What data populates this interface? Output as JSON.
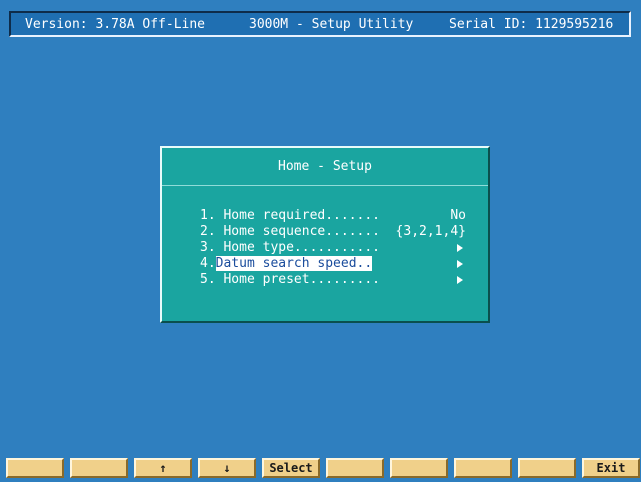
{
  "header": {
    "version": "Version: 3.78A Off-Line",
    "title": "3000M - Setup Utility",
    "serial": "Serial ID: 1129595216"
  },
  "dialog": {
    "title": "Home - Setup",
    "items": [
      {
        "label": "1. Home required.......",
        "value": "No",
        "submenu": false
      },
      {
        "label": "2. Home sequence.......",
        "value": "{3,2,1,4}",
        "submenu": false
      },
      {
        "label": "3. Home type...........",
        "value": "",
        "submenu": true
      },
      {
        "label_prefix": "4.",
        "label": "Datum search speed..",
        "value": "",
        "submenu": true,
        "selected": true
      },
      {
        "label": "5. Home preset.........",
        "value": "",
        "submenu": true
      }
    ]
  },
  "function_keys": [
    "",
    "",
    "↑",
    "↓",
    "Select",
    "",
    "",
    "",
    "",
    "Exit"
  ],
  "colors": {
    "background": "#2f7fbf",
    "dialog": "#1aa5a0",
    "function_key": "#f0d08a"
  }
}
